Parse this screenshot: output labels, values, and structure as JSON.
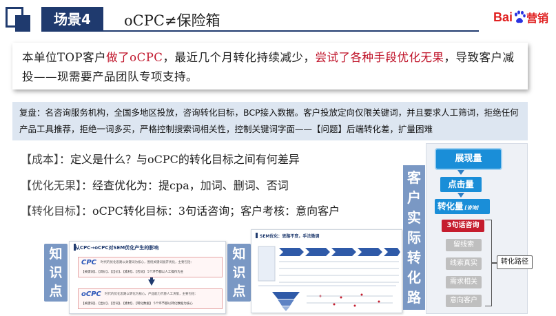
{
  "header": {
    "scene_tag": "场景4",
    "title": "oCPC≠保险箱",
    "logo_left": "Bai",
    "logo_right": "营销"
  },
  "problem": {
    "part1": "本单位TOP客户",
    "part2_red": "做了oCPC",
    "part3": "，最近几个月转化持续减少，",
    "part4_red": "尝试了各种手段优化无果",
    "part5": "，导致客户减投——现需要产品团队专项支持。"
  },
  "review": {
    "text": "复盘：名咨询服务机构，全国多地区投放，咨询转化目标，BCP接入数据。客户投放定向仅限关键词，并且要求人工筛词，拒绝任何产品工具推荐，拒绝一词多买，严格控制搜索词相关性，控制关键词字面——【问题】后端转化差，扩量困难"
  },
  "questions": [
    {
      "tag": "【成本】",
      "text": "：定义是什么？与oCPC的转化目标之间有何差异"
    },
    {
      "tag": "【优化无果】",
      "text": "：经查优化为：提cpa，加词、删词、否词"
    },
    {
      "tag": "【转化目标】",
      "text": "：oCPC转化目标：3句话咨询；客户考核：意向客户"
    }
  ],
  "knowledge_points": {
    "label": "知识点",
    "thumb1": {
      "title": "从CPC→oCPC对SEM优化产生的影响",
      "card1_label": "CPC",
      "card1_desc": "时代的优化思路以关键词为核心，围绕关键词展开优化，主要包括：",
      "card1_items": "【关键词】、【调价】、【出价】、【素材】、【否词】 5个环节都以人工操作为主",
      "card2_label": "oCPC",
      "card2_desc": "时代的优化思路以转化为核心，产品能力代替人工决策，主要包括：",
      "card2_items": "【关键词】、【出价】、【否词】、【素材】、【转化数据】 5个环节都以转化数据为核心"
    },
    "thumb2": {
      "title": "SEM优化：思路不变，手法微调"
    }
  },
  "side_title": "客户实际转化路径",
  "flow": {
    "steps": [
      "展现量",
      "点击量",
      "转化量",
      "3句话咨询",
      "留线索",
      "线索真实",
      "需求相关",
      "意向客户"
    ],
    "step3_sub": "[咨询]",
    "path_label": "转化路径"
  },
  "colors": {
    "navy": "#1f3a6e",
    "accent_red": "#c0152b",
    "flow_blue": "#1a8ed8",
    "flow_red": "#c51d2e",
    "flow_gray": "#bfbfbf",
    "review_bg": "#dde6f1",
    "label_blue": "#7a98c4"
  }
}
